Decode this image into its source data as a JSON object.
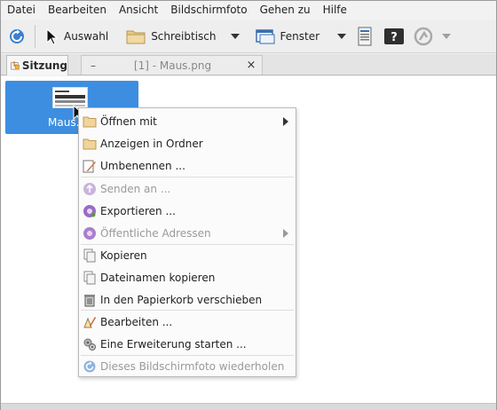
{
  "menubar": {
    "items": [
      "Datei",
      "Bearbeiten",
      "Ansicht",
      "Bildschirmfoto",
      "Gehen zu",
      "Hilfe"
    ]
  },
  "toolbar": {
    "auswahl_label": "Auswahl",
    "schreibtisch_label": "Schreibtisch",
    "fenster_label": "Fenster"
  },
  "tabs": {
    "session_label": "Sitzung",
    "file_tab_dash": "–",
    "file_tab_label": "[1] - Maus.png",
    "file_tab_close": "×"
  },
  "thumbnail": {
    "label": "Maus."
  },
  "context_menu": {
    "items": [
      {
        "label": "Öffnen mit",
        "icon": "folder-icon",
        "enabled": true,
        "submenu": true
      },
      {
        "label": "Anzeigen in Ordner",
        "icon": "folder-icon",
        "enabled": true,
        "submenu": false
      },
      {
        "label": "Umbenennen ...",
        "icon": "rename-icon",
        "enabled": true,
        "submenu": false
      },
      {
        "label": "Senden an ...",
        "icon": "upload-icon",
        "enabled": false,
        "submenu": false
      },
      {
        "label": "Exportieren ...",
        "icon": "export-icon",
        "enabled": true,
        "submenu": false
      },
      {
        "label": "Öffentliche Adressen",
        "icon": "export-icon",
        "enabled": false,
        "submenu": true
      },
      {
        "label": "Kopieren",
        "icon": "copy-icon",
        "enabled": true,
        "submenu": false
      },
      {
        "label": "Dateinamen kopieren",
        "icon": "copy-icon",
        "enabled": true,
        "submenu": false
      },
      {
        "label": "In den Papierkorb verschieben",
        "icon": "trash-icon",
        "enabled": true,
        "submenu": false
      },
      {
        "label": "Bearbeiten ...",
        "icon": "edit-icon",
        "enabled": true,
        "submenu": false
      },
      {
        "label": "Eine Erweiterung starten ...",
        "icon": "plugin-icon",
        "enabled": true,
        "submenu": false
      },
      {
        "label": "Dieses Bildschirmfoto wiederholen",
        "icon": "redo-icon",
        "enabled": false,
        "submenu": false
      }
    ]
  }
}
